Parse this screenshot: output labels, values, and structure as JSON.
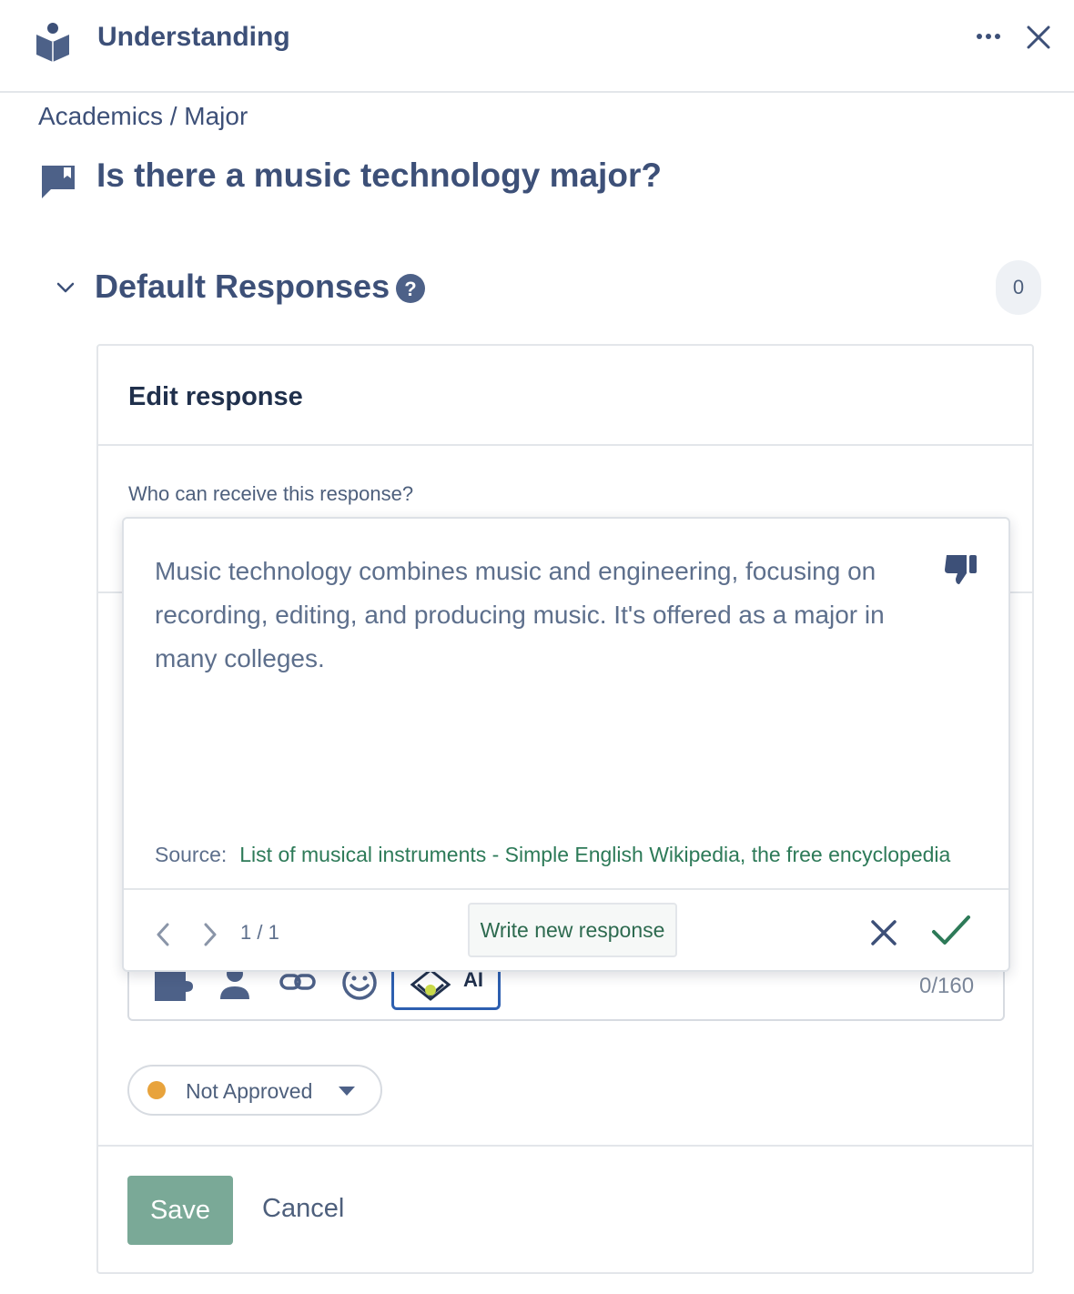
{
  "header": {
    "title": "Understanding",
    "icons": {
      "app": "reading-person-icon",
      "more": "ellipsis-icon",
      "close": "close-icon"
    }
  },
  "breadcrumb": "Academics / Major",
  "question": {
    "title": "Is there a music technology major?",
    "icon": "book-open-icon"
  },
  "section": {
    "title": "Default Responses",
    "count": "0"
  },
  "edit": {
    "title": "Edit response",
    "who_label": "Who can receive this response?",
    "char_count": "0/160",
    "ai_label": "AI",
    "status": {
      "label": "Not Approved",
      "color": "#e8a33c"
    },
    "save_label": "Save",
    "cancel_label": "Cancel"
  },
  "ai_popup": {
    "text": "Music technology combines music and engineering, focusing on recording, editing, and producing music. It's offered as a major in many colleges.",
    "source_label": "Source:",
    "source_link": "List of musical instruments - Simple English Wikipedia, the free encyclopedia",
    "page": "1 / 1",
    "write_new_label": "Write new response"
  },
  "colors": {
    "accent_navy": "#3d5078",
    "save_green": "#7aa997",
    "link_green": "#2d7a58",
    "ai_border": "#2d5fb0"
  }
}
